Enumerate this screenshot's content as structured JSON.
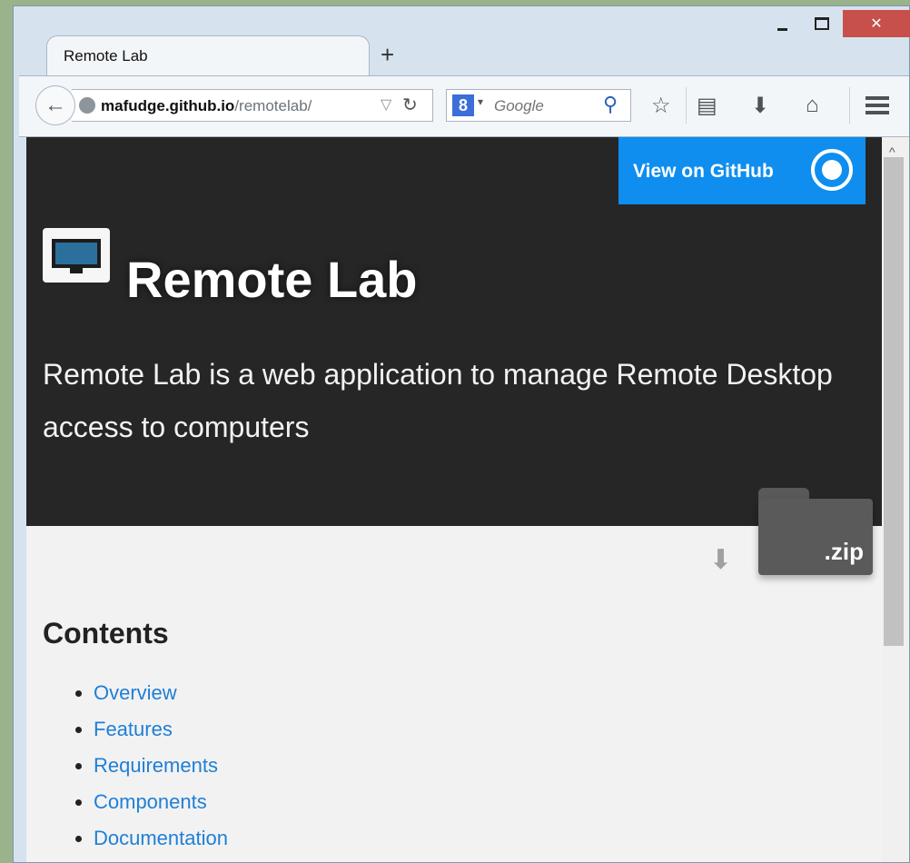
{
  "window": {
    "close_label": "✕"
  },
  "tab": {
    "title": "Remote Lab",
    "new_tab_label": "+"
  },
  "toolbar": {
    "back_label": "←",
    "url_host": "mafudge.github.io",
    "url_path": "/remotelab/",
    "url_dropdown": "▽",
    "reload_label": "↻",
    "search_engine_letter": "8",
    "search_engine_caret": "▾",
    "search_placeholder": "Google",
    "search_icon_glyph": "⚲",
    "star_glyph": "☆",
    "reading_glyph": "▤",
    "download_glyph": "⬇",
    "home_glyph": "⌂"
  },
  "page": {
    "github_button_label": "View on GitHub",
    "title": "Remote Lab",
    "description": "Remote Lab is a web application to manage Remote Desktop access to computers",
    "zip_label": ".zip",
    "download_arrow": "⬇",
    "contents_heading": "Contents",
    "toc": [
      "Overview",
      "Features",
      "Requirements",
      "Components",
      "Documentation"
    ]
  },
  "scrollbar": {
    "up_arrow": "^",
    "thumb_fraction": 0.7
  },
  "colors": {
    "accent_blue": "#0f8ef0",
    "link_blue": "#1f7fd6",
    "hero_bg": "#262626",
    "close_red": "#c7504a"
  }
}
